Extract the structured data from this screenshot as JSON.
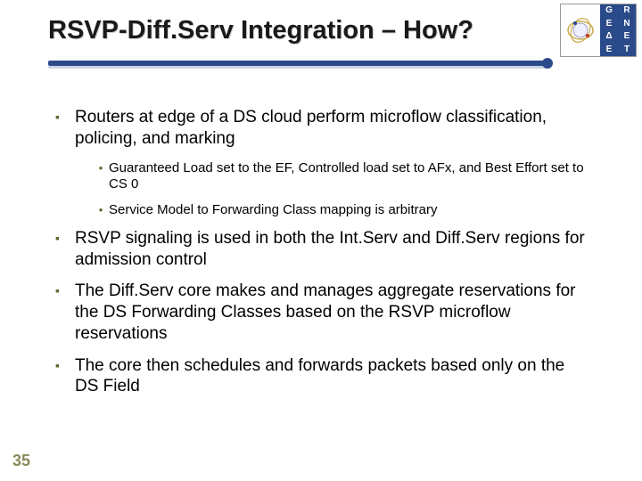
{
  "title": "RSVP-Diff.Serv Integration – How?",
  "logo": {
    "letters": [
      "G",
      "R",
      "N",
      "E",
      "T",
      "E",
      "Δ",
      "E"
    ]
  },
  "bullets": [
    {
      "text": "Routers at edge of a DS cloud perform microflow classification, policing, and marking",
      "sub": [
        "Guaranteed Load set to the EF, Controlled load set to AFx, and Best Effort set to CS 0",
        "Service Model to Forwarding Class mapping is arbitrary"
      ]
    },
    {
      "text": "RSVP signaling is used in both the Int.Serv and Diff.Serv regions for admission control",
      "sub": []
    },
    {
      "text": "The Diff.Serv core makes and manages aggregate reservations for the DS Forwarding Classes based on the RSVP microflow reservations",
      "sub": []
    },
    {
      "text": "The core then schedules and forwards packets based only on the DS Field",
      "sub": []
    }
  ],
  "slide_number": "35"
}
